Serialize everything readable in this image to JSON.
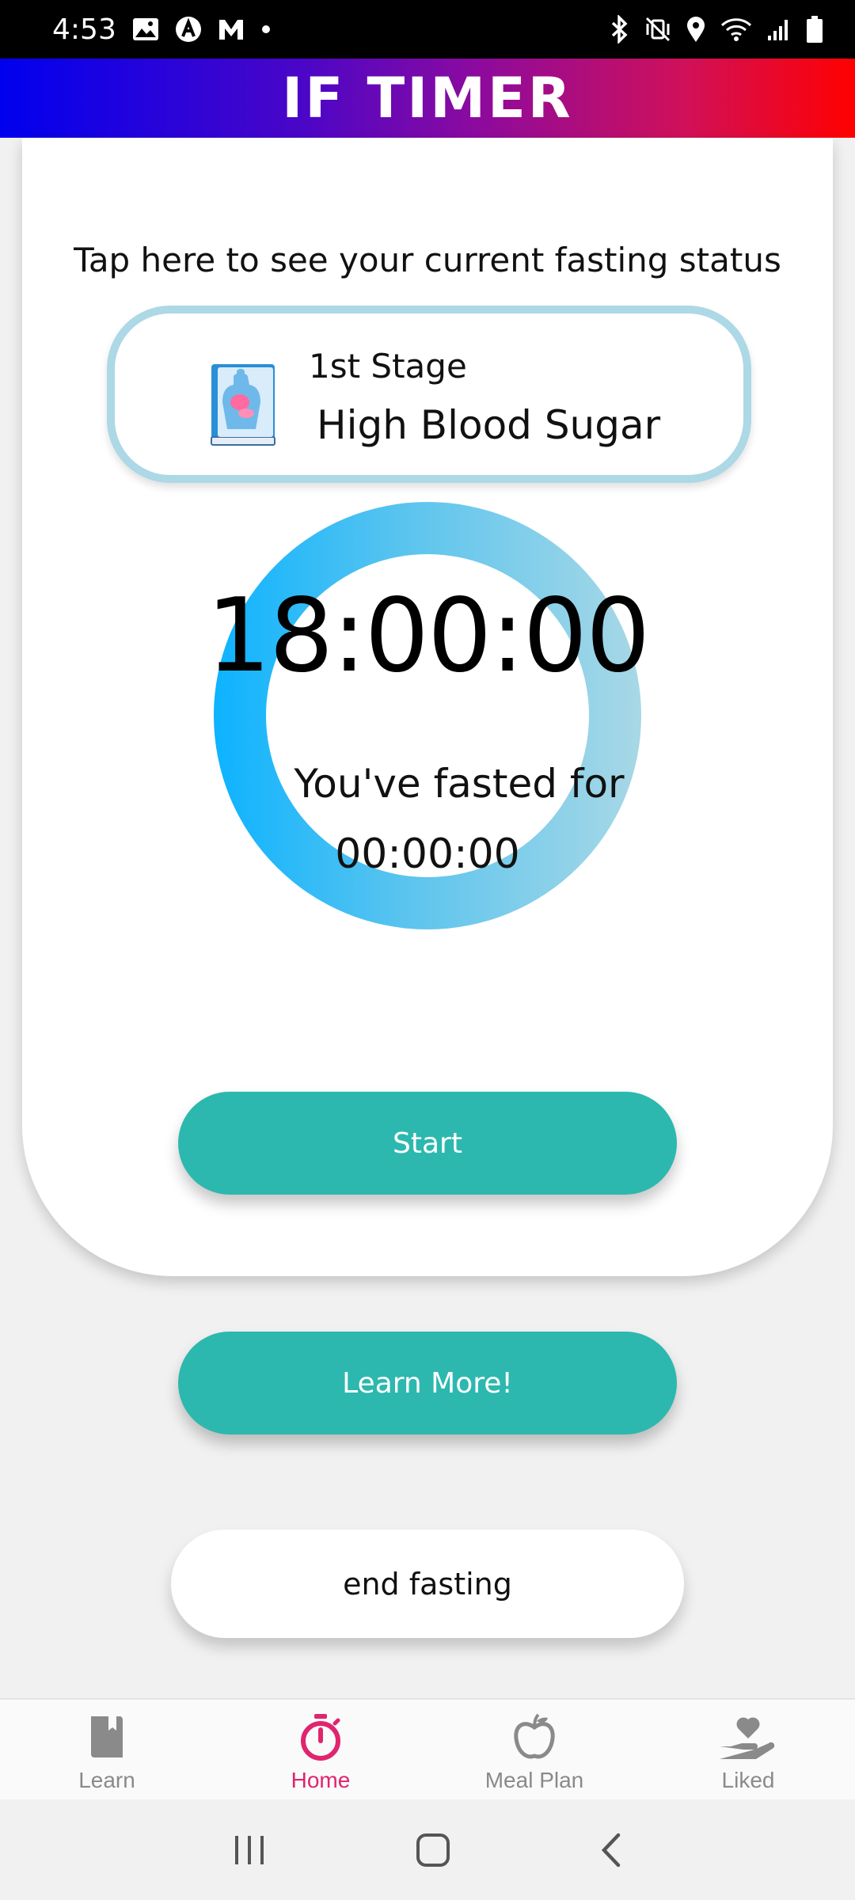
{
  "status_bar": {
    "time": "4:53",
    "left_icons": [
      "image-icon",
      "a-circle-icon",
      "m-logo-icon",
      "dot-icon"
    ],
    "right_icons": [
      "bluetooth-icon",
      "mute-vibrate-icon",
      "location-icon",
      "wifi-icon",
      "signal-icon",
      "battery-icon"
    ]
  },
  "header": {
    "title": "IF TIMER"
  },
  "status_card": {
    "hint": "Tap here to see your current fasting status",
    "stage_label": "1st Stage",
    "stage_name": "High Blood Sugar",
    "icon": "anatomy-book-icon"
  },
  "timer": {
    "countdown": "18:00:00",
    "fasted_label": "You've fasted for",
    "fasted_time": "00:00:00"
  },
  "buttons": {
    "start": "Start",
    "learn_more": "Learn More!",
    "end_fasting": "end fasting"
  },
  "bottom_nav": {
    "items": [
      {
        "label": "Learn",
        "icon": "book-icon",
        "active": false
      },
      {
        "label": "Home",
        "icon": "stopwatch-icon",
        "active": true
      },
      {
        "label": "Meal Plan",
        "icon": "apple-icon",
        "active": false
      },
      {
        "label": "Liked",
        "icon": "heart-hand-icon",
        "active": false
      }
    ]
  },
  "system_nav": {
    "icons": [
      "recents-icon",
      "home-icon",
      "back-icon"
    ]
  },
  "colors": {
    "accent": "#e0246e",
    "button": "#2cb8ae",
    "ring_start": "#0db3ff",
    "ring_end": "#a8d8e6",
    "stage_border": "#add8e6"
  }
}
